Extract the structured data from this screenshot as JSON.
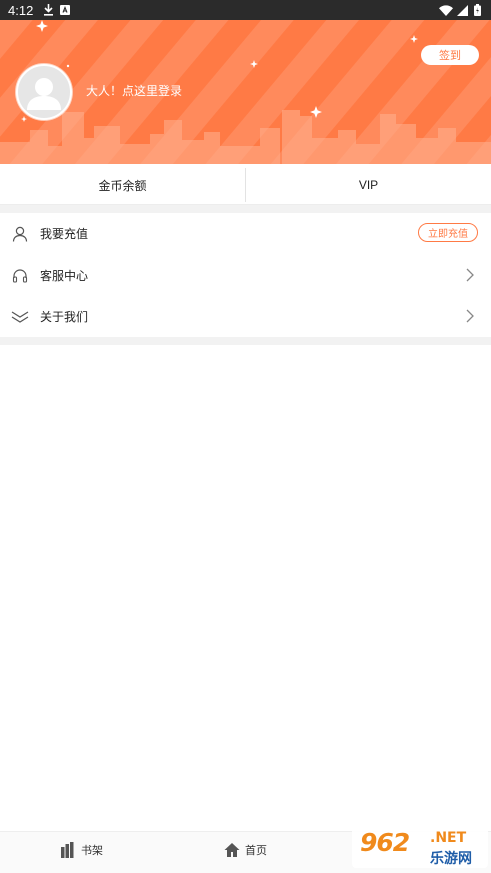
{
  "status_bar": {
    "time": "4:12",
    "icons": [
      "download-icon",
      "app-notification-icon",
      "wifi-icon",
      "signal-icon",
      "battery-icon"
    ]
  },
  "header": {
    "login_prompt": "大人！点这里登录",
    "signin_label": "签到",
    "accent_color": "#ff7a45"
  },
  "tabs": [
    {
      "label": "金币余额"
    },
    {
      "label": "VIP"
    }
  ],
  "menu": [
    {
      "label": "我要充值",
      "icon": "user-icon",
      "action_label": "立即充值"
    },
    {
      "label": "客服中心",
      "icon": "headset-icon"
    },
    {
      "label": "关于我们",
      "icon": "double-chevron-down-icon"
    }
  ],
  "bottom_nav": [
    {
      "label": "书架",
      "icon": "bookshelf-icon"
    },
    {
      "label": "首页",
      "icon": "home-icon"
    }
  ],
  "watermark": {
    "logo": "962",
    "suffix": ".NET",
    "subtitle": "乐游网"
  }
}
